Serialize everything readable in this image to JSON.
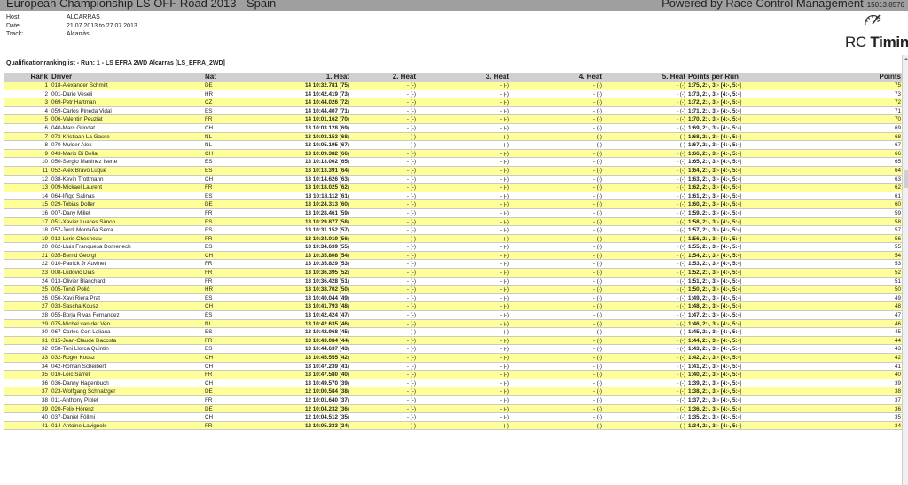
{
  "header": {
    "title": "European Championship LS OFF Road 2013 - Spain",
    "powered": "Powered by Race Control Management",
    "version": "15013.8576"
  },
  "meta": [
    {
      "label": "Host:",
      "value": "ALCARRAS"
    },
    {
      "label": "Date:",
      "value": "21.07.2013 to 27.07.2013"
    },
    {
      "label": "Track:",
      "value": "Alcarràs"
    }
  ],
  "logo": {
    "rc": "RC",
    "timing": "Timing"
  },
  "caption": "Qualificationrankinglist - Run: 1 - LS EFRA 2WD Alcarras [LS_EFRA_2WD]",
  "columns": {
    "rank": "Rank",
    "driver": "Driver",
    "nat": "Nat",
    "h1": "1. Heat",
    "h2": "2. Heat",
    "h3": "3. Heat",
    "h4": "4. Heat",
    "h5": "5. Heat",
    "ppr": "Points per Run",
    "points": "Points"
  },
  "rows": [
    [
      "1",
      "018-Alexander Schmitt",
      "DE",
      "14 10:32.781 (75)",
      "75"
    ],
    [
      "2",
      "001-Dario Veseli",
      "HR",
      "14 10:42.419 (73)",
      "73"
    ],
    [
      "3",
      "069-Petr Hartman",
      "CZ",
      "14 10:44.026 (72)",
      "72"
    ],
    [
      "4",
      "059-Carlos Pineda Vidal",
      "ES",
      "14 10:44.407 (71)",
      "71"
    ],
    [
      "5",
      "006-Valentin Peuziat",
      "FR",
      "14 10:01.162 (70)",
      "70"
    ],
    [
      "6",
      "040-Marc Grindat",
      "CH",
      "13 10:03.128 (69)",
      "69"
    ],
    [
      "7",
      "072-Kristiaan La Gasse",
      "NL",
      "13 10:03.153 (68)",
      "68"
    ],
    [
      "8",
      "070-Mulder Alex",
      "NL",
      "13 10:05.195 (67)",
      "67"
    ],
    [
      "9",
      "043-Mario Di Bella",
      "CH",
      "13 10:09.382 (66)",
      "66"
    ],
    [
      "10",
      "050-Sergio Martinez Iserte",
      "ES",
      "13 10:13.002 (65)",
      "65"
    ],
    [
      "11",
      "052-Alex Bravo Luque",
      "ES",
      "13 10:13.391 (64)",
      "64"
    ],
    [
      "12",
      "038-Kevin Trottmann",
      "CH",
      "13 10:14.626 (63)",
      "63"
    ],
    [
      "13",
      "009-Mickael Laurent",
      "FR",
      "13 10:18.025 (62)",
      "62"
    ],
    [
      "14",
      "064-Iñigo Salinas",
      "ES",
      "13 10:18.112 (61)",
      "61"
    ],
    [
      "15",
      "029-Tobias Doller",
      "DE",
      "13 10:24.313 (60)",
      "60"
    ],
    [
      "16",
      "007-Dany Millet",
      "FR",
      "13 10:28.461 (59)",
      "59"
    ],
    [
      "17",
      "051-Xavier Luaces Simon",
      "ES",
      "13 10:29.877 (58)",
      "58"
    ],
    [
      "18",
      "057-Jordi Montaña Serra",
      "ES",
      "13 10:31.152 (57)",
      "57"
    ],
    [
      "19",
      "012-Loris Chesneau",
      "FR",
      "13 10:34.019 (56)",
      "56"
    ],
    [
      "20",
      "062-Lluis Franquesa Domenech",
      "ES",
      "13 10:34.639 (55)",
      "55"
    ],
    [
      "21",
      "035-Bernd Georgi",
      "CH",
      "13 10:35.808 (54)",
      "54"
    ],
    [
      "22",
      "010-Patrick Jr Auvinet",
      "FR",
      "13 10:35.829 (53)",
      "53"
    ],
    [
      "23",
      "008-Ludovic Dias",
      "FR",
      "13 10:36.395 (52)",
      "52"
    ],
    [
      "24",
      "013-Olivier Blanchard",
      "FR",
      "13 10:36.428 (51)",
      "51"
    ],
    [
      "25",
      "005-Tonči Polić",
      "HR",
      "13 10:38.702 (50)",
      "50"
    ],
    [
      "26",
      "056-Xavi Riera Prat",
      "ES",
      "13 10:40.044 (49)",
      "49"
    ],
    [
      "27",
      "033-Sascha Kousz",
      "CH",
      "13 10:41.793 (48)",
      "48"
    ],
    [
      "28",
      "055-Borja Rivas Fernandez",
      "ES",
      "13 10:42.424 (47)",
      "47"
    ],
    [
      "29",
      "075-Michel van der Ven",
      "NL",
      "13 10:42.635 (46)",
      "46"
    ],
    [
      "30",
      "067-Carles Cort Laliana",
      "ES",
      "13 10:42.968 (45)",
      "45"
    ],
    [
      "31",
      "015-Jean-Claude Dacosta",
      "FR",
      "13 10:43.084 (44)",
      "44"
    ],
    [
      "32",
      "058-Toni Llorca Quintin",
      "ES",
      "13 10:44.637 (43)",
      "43"
    ],
    [
      "33",
      "032-Roger Kousz",
      "CH",
      "13 10:45.555 (42)",
      "42"
    ],
    [
      "34",
      "042-Roman Scheibert",
      "CH",
      "13 10:47.239 (41)",
      "41"
    ],
    [
      "35",
      "016-Loïc Sarret",
      "FR",
      "13 10:47.580 (40)",
      "40"
    ],
    [
      "36",
      "036-Danny Hagenbuch",
      "CH",
      "13 10:49.570 (39)",
      "39"
    ],
    [
      "37",
      "023-Wolfgang Schnalzger",
      "DE",
      "12 10:00.584 (38)",
      "38"
    ],
    [
      "38",
      "011-Anthony Piolet",
      "FR",
      "12 10:01.640 (37)",
      "37"
    ],
    [
      "39",
      "020-Felix Hörenz",
      "DE",
      "12 10:04.232 (36)",
      "36"
    ],
    [
      "40",
      "037-Daniel Föllmi",
      "CH",
      "12 10:04.512 (35)",
      "35"
    ],
    [
      "41",
      "014-Antoine Lavignole",
      "FR",
      "12 10:05.333 (34)",
      "34"
    ]
  ],
  "empty_heat": "- (-)",
  "ppr_suffix": "2:-, 3:- [4:-, 5:-]"
}
